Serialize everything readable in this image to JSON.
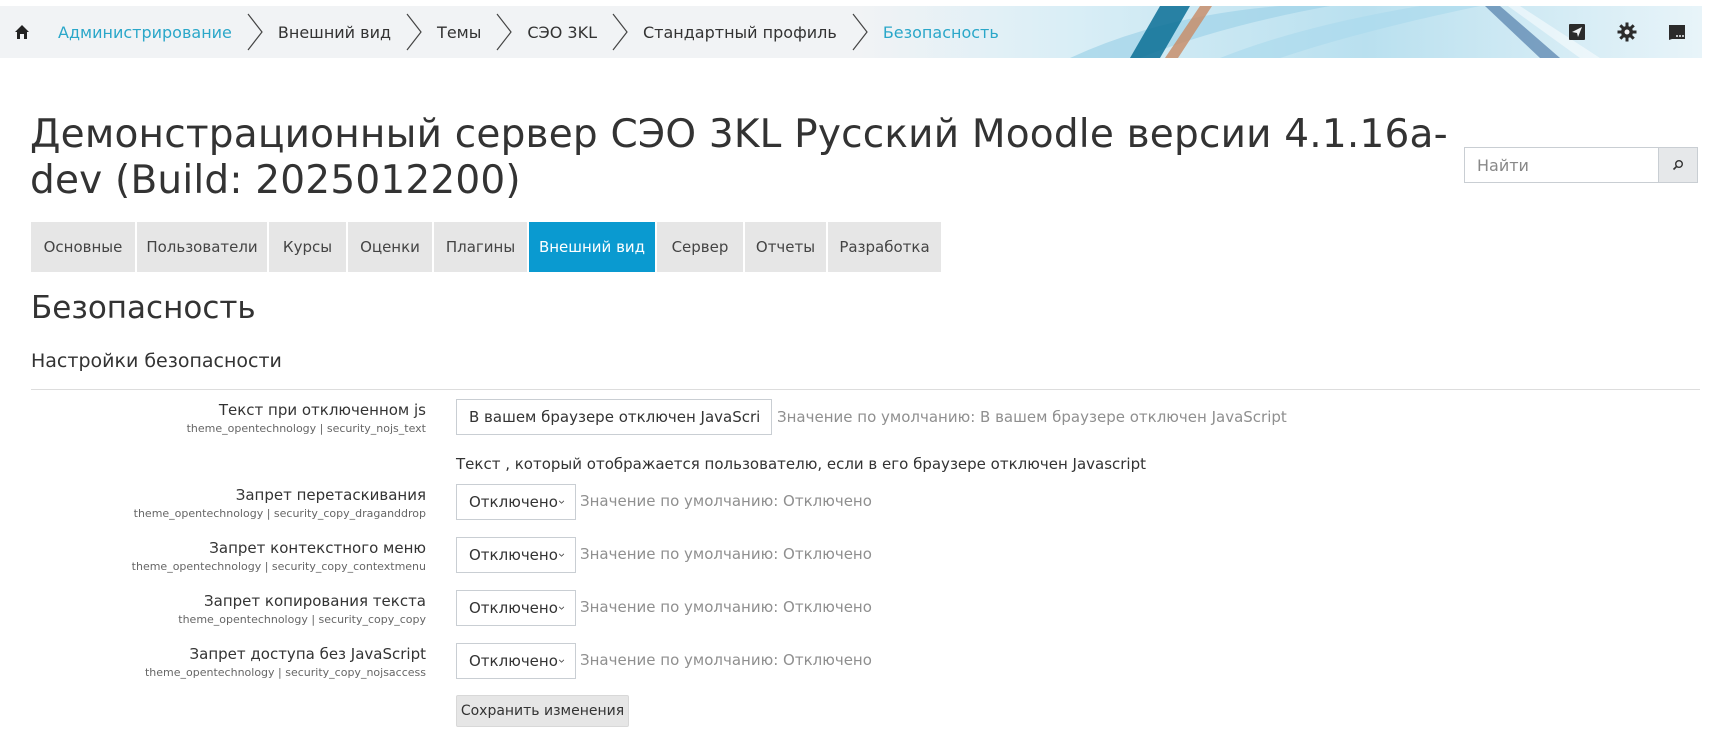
{
  "breadcrumb": {
    "items": [
      {
        "label": "Администрирование",
        "link": true
      },
      {
        "label": "Внешний вид",
        "link": false
      },
      {
        "label": "Темы",
        "link": false
      },
      {
        "label": "СЭО 3KL",
        "link": false
      },
      {
        "label": "Стандартный профиль",
        "link": false
      },
      {
        "label": "Безопасность",
        "link": true
      }
    ]
  },
  "topbar": {
    "icons": [
      "home-icon",
      "send-icon",
      "gear-icon",
      "chat-icon"
    ]
  },
  "header": {
    "title": "Демонстрационный сервер СЭО 3KL Русский Moodle версии 4.1.16a-dev (Build: 2025012200)"
  },
  "search": {
    "placeholder": "Найти",
    "icon": "search-icon"
  },
  "tabs": [
    {
      "label": "Основные",
      "active": false
    },
    {
      "label": "Пользователи",
      "active": false
    },
    {
      "label": "Курсы",
      "active": false
    },
    {
      "label": "Оценки",
      "active": false
    },
    {
      "label": "Плагины",
      "active": false
    },
    {
      "label": "Внешний вид",
      "active": true
    },
    {
      "label": "Сервер",
      "active": false
    },
    {
      "label": "Отчеты",
      "active": false
    },
    {
      "label": "Разработка",
      "active": false
    }
  ],
  "page": {
    "section_title": "Безопасность",
    "subsection_title": "Настройки безопасности"
  },
  "settings": {
    "nojs_text": {
      "label": "Текст при отключенном js",
      "key": "theme_opentechnology | security_nojs_text",
      "value": "В вашем браузере отключен JavaScript",
      "default": "Значение по умолчанию: В вашем браузере отключен JavaScript",
      "description": "Текст , который отображается пользователю, если в его браузере отключен Javascript"
    },
    "draganddrop": {
      "label": "Запрет перетаскивания",
      "key": "theme_opentechnology | security_copy_draganddrop",
      "value": "Отключено",
      "default": "Значение по умолчанию: Отключено"
    },
    "contextmenu": {
      "label": "Запрет контекстного меню",
      "key": "theme_opentechnology | security_copy_contextmenu",
      "value": "Отключено",
      "default": "Значение по умолчанию: Отключено"
    },
    "copy": {
      "label": "Запрет копирования текста",
      "key": "theme_opentechnology | security_copy_copy",
      "value": "Отключено",
      "default": "Значение по умолчанию: Отключено"
    },
    "nojsaccess": {
      "label": "Запрет доступа без JavaScript",
      "key": "theme_opentechnology | security_copy_nojsaccess",
      "value": "Отключено",
      "default": "Значение по умолчанию: Отключено"
    }
  },
  "actions": {
    "save_label": "Сохранить изменения"
  },
  "colors": {
    "accent": "#0a9ad0",
    "link": "#2aa7c9",
    "tab_bg": "#e6e6e6"
  }
}
